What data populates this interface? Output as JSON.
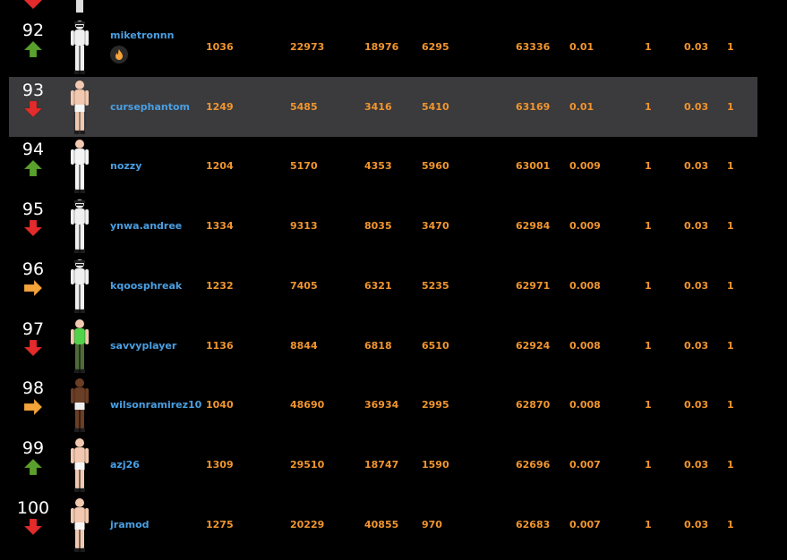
{
  "colors": {
    "highlight_row": "#3b3a3c",
    "player_link": "#4a9fe2",
    "stat": "#f0952e",
    "up": "#5aa02c",
    "down": "#e32b2b",
    "same": "#f3a33a"
  },
  "rows": [
    {
      "rank": "92",
      "trend": "up",
      "avatar": "white-suit",
      "player": "miketronnn",
      "has_badge": true,
      "stats": [
        "1036",
        "22973",
        "18976",
        "6295",
        "63336",
        "0.01",
        "1",
        "0.03",
        "1"
      ]
    },
    {
      "rank": "93",
      "trend": "down",
      "avatar": "shirtless",
      "player": "cursephantom",
      "has_badge": false,
      "highlighted": true,
      "stats": [
        "1249",
        "5485",
        "3416",
        "5410",
        "63169",
        "0.01",
        "1",
        "0.03",
        "1"
      ]
    },
    {
      "rank": "94",
      "trend": "up",
      "avatar": "white-tee",
      "player": "nozzy",
      "has_badge": false,
      "stats": [
        "1204",
        "5170",
        "4353",
        "5960",
        "63001",
        "0.009",
        "1",
        "0.03",
        "1"
      ]
    },
    {
      "rank": "95",
      "trend": "down",
      "avatar": "white-suit",
      "player": "ynwa.andree",
      "has_badge": false,
      "stats": [
        "1334",
        "9313",
        "8035",
        "3470",
        "62984",
        "0.009",
        "1",
        "0.03",
        "1"
      ]
    },
    {
      "rank": "96",
      "trend": "same",
      "avatar": "white-suit",
      "player": "kqoosphreak",
      "has_badge": false,
      "stats": [
        "1232",
        "7405",
        "6321",
        "5235",
        "62971",
        "0.008",
        "1",
        "0.03",
        "1"
      ]
    },
    {
      "rank": "97",
      "trend": "down",
      "avatar": "green-camo",
      "player": "savvyplayer",
      "has_badge": false,
      "stats": [
        "1136",
        "8844",
        "6818",
        "6510",
        "62924",
        "0.008",
        "1",
        "0.03",
        "1"
      ]
    },
    {
      "rank": "98",
      "trend": "same",
      "avatar": "dark-skin",
      "player": "wilsonramirez10",
      "has_badge": false,
      "stats": [
        "1040",
        "48690",
        "36934",
        "2995",
        "62870",
        "0.008",
        "1",
        "0.03",
        "1"
      ]
    },
    {
      "rank": "99",
      "trend": "up",
      "avatar": "shirtless",
      "player": "azj26",
      "has_badge": false,
      "stats": [
        "1309",
        "29510",
        "18747",
        "1590",
        "62696",
        "0.007",
        "1",
        "0.03",
        "1"
      ]
    },
    {
      "rank": "100",
      "trend": "down",
      "avatar": "shirtless",
      "player": "jramod",
      "has_badge": false,
      "stats": [
        "1275",
        "20229",
        "40855",
        "970",
        "62683",
        "0.007",
        "1",
        "0.03",
        "1"
      ]
    }
  ]
}
